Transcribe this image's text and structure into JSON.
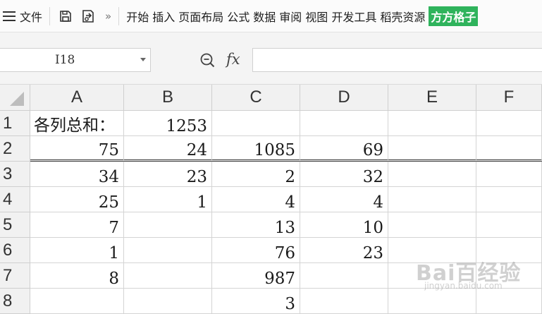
{
  "menubar": {
    "file_label": "文件",
    "quick_icons": [
      "save-icon",
      "export-icon"
    ],
    "more_label": "»",
    "tabs": [
      "开始",
      "插入",
      "页面布局",
      "公式",
      "数据",
      "审阅",
      "视图",
      "开发工具",
      "稻壳资源"
    ],
    "brand_tab": "方方格子",
    "brand_color": "#2fb35c"
  },
  "formula_bar": {
    "name_box": "I18",
    "fx_label": "fx",
    "formula": ""
  },
  "sheet": {
    "columns": [
      "A",
      "B",
      "C",
      "D",
      "E",
      "F"
    ],
    "rows": [
      "1",
      "2",
      "3",
      "4",
      "5",
      "6",
      "7",
      "8"
    ],
    "cells": [
      [
        "各列总和：",
        "1253",
        "",
        "",
        "",
        ""
      ],
      [
        "75",
        "24",
        "1085",
        "69",
        "",
        ""
      ],
      [
        "34",
        "23",
        "2",
        "32",
        "",
        ""
      ],
      [
        "25",
        "1",
        "4",
        "4",
        "",
        ""
      ],
      [
        "7",
        "",
        "13",
        "10",
        "",
        ""
      ],
      [
        "1",
        "",
        "76",
        "23",
        "",
        ""
      ],
      [
        "8",
        "",
        "987",
        "",
        "",
        ""
      ],
      [
        "",
        "",
        "3",
        "",
        "",
        ""
      ]
    ]
  },
  "watermark": {
    "main": "Bai百经验",
    "sub": "jingyan.baidu.com"
  }
}
